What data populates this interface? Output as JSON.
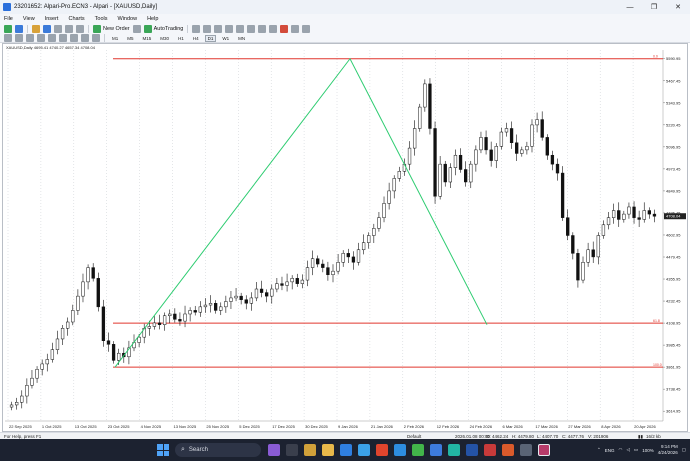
{
  "window": {
    "title": "23201652: Alpari-Pro.ECN3 - Alpari - [XAUUSD,Daily]",
    "controls": [
      "—",
      "❐",
      "✕"
    ]
  },
  "menu": [
    "File",
    "View",
    "Insert",
    "Charts",
    "Tools",
    "Window",
    "Help"
  ],
  "toolbar": {
    "new_order": "New Order",
    "autotrading": "AutoTrading"
  },
  "timeframes": [
    "M1",
    "M5",
    "M15",
    "M30",
    "H1",
    "H4",
    "D1",
    "W1",
    "MN"
  ],
  "active_timeframe": "D1",
  "chart": {
    "header": "XAUUSD,Daily  4695.41 4740.27 4657.34 4708.04",
    "price_labels": [
      "5590.95",
      "5467.45",
      "5343.95",
      "5220.45",
      "5096.95",
      "4973.45",
      "4849.95",
      "4726.45",
      "4602.95",
      "4479.45",
      "4355.95",
      "4232.45",
      "4108.95",
      "3985.45",
      "3861.95",
      "3738.45",
      "3614.95"
    ],
    "current_price": "4708.04",
    "date_labels": [
      "22 Sep 2025",
      "1 Oct 2025",
      "13 Oct 2025",
      "23 Oct 2025",
      "4 Nov 2025",
      "13 Nov 2025",
      "25 Nov 2025",
      "5 Dec 2025",
      "17 Dec 2025",
      "30 Dec 2025",
      "9 Jan 2026",
      "21 Jan 2026",
      "2 Feb 2026",
      "12 Feb 2026",
      "24 Feb 2026",
      "6 Mar 2026",
      "17 Mar 2026",
      "27 Mar 2026",
      "8 Apr 2026",
      "20 Apr 2026"
    ],
    "fib_levels": [
      {
        "label": "0.0",
        "price": 5590.95
      },
      {
        "label": "61.8",
        "price": 4108.95
      },
      {
        "label": "100.0",
        "price": 3861.95
      }
    ],
    "colors": {
      "bull": "#ffffff",
      "bear": "#111111",
      "fib": "#e0362e",
      "zigzag": "#2ecc71",
      "grid": "#c8ccd2"
    }
  },
  "chart_data": {
    "type": "candlestick",
    "title": "XAUUSD,Daily",
    "ylim": [
      3560,
      5640
    ],
    "zigzag": [
      {
        "date": "24 Oct 2025",
        "price": 3861.95
      },
      {
        "date": "29 Jan 2026",
        "price": 5590.95
      },
      {
        "date": "19 Mar 2026",
        "price": 4100.0
      }
    ],
    "closes": [
      3650,
      3665,
      3700,
      3760,
      3800,
      3850,
      3880,
      3905,
      3960,
      4020,
      4080,
      4115,
      4180,
      4260,
      4340,
      4420,
      4360,
      4200,
      4010,
      3990,
      3900,
      3940,
      3920,
      3970,
      4000,
      4030,
      4080,
      4090,
      4110,
      4100,
      4150,
      4160,
      4130,
      4120,
      4160,
      4180,
      4170,
      4200,
      4210,
      4220,
      4180,
      4200,
      4230,
      4250,
      4260,
      4240,
      4220,
      4250,
      4300,
      4280,
      4260,
      4300,
      4330,
      4320,
      4340,
      4360,
      4330,
      4350,
      4420,
      4470,
      4440,
      4420,
      4380,
      4400,
      4450,
      4500,
      4480,
      4450,
      4520,
      4560,
      4600,
      4640,
      4700,
      4780,
      4850,
      4920,
      4960,
      5000,
      5090,
      5200,
      5320,
      5450,
      5200,
      4820,
      5000,
      4900,
      4980,
      5050,
      4970,
      4900,
      5000,
      5080,
      5150,
      5080,
      5020,
      5100,
      5180,
      5200,
      5120,
      5060,
      5080,
      5100,
      5220,
      5250,
      5150,
      5050,
      5000,
      4950,
      4700,
      4600,
      4500,
      4350,
      4450,
      4520,
      4480,
      4600,
      4660,
      4700,
      4740,
      4690,
      4720,
      4760,
      4700,
      4690,
      4740,
      4720,
      4708
    ]
  },
  "status": {
    "help": "For Help, press F1",
    "profile": "Default",
    "datetime": "2026.01.08 00:00",
    "open": "O: 4462.24",
    "high": "H: 4479.80",
    "low": "L: 4407.70",
    "close": "C: 4477.76",
    "volume": "V: 201906",
    "traffic": "16/2 kb"
  },
  "taskbar": {
    "search_placeholder": "Search",
    "language": "ENG",
    "battery": "100%",
    "time": "9:14 PM",
    "date": "4/24/2026"
  }
}
